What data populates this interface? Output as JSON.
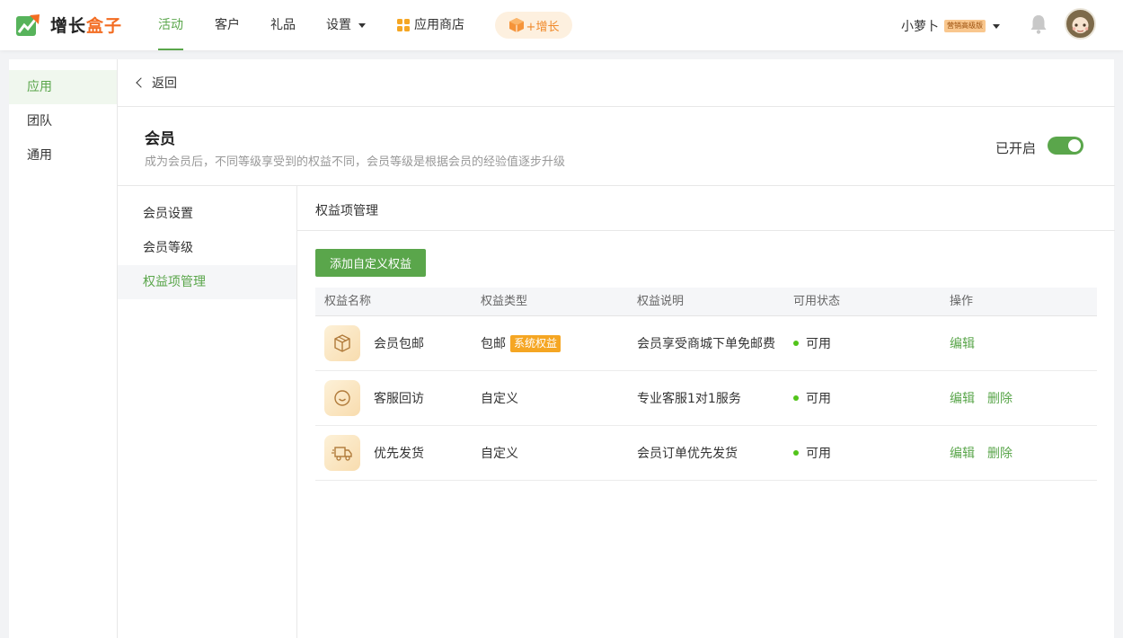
{
  "brand": {
    "name_part1": "增长",
    "name_part2": "盒子"
  },
  "nav": {
    "items": [
      "活动",
      "客户",
      "礼品",
      "设置",
      "应用商店"
    ],
    "grow_label": "+增长"
  },
  "user": {
    "name": "小萝卜",
    "badge": "营销高级版"
  },
  "sidebar": {
    "items": [
      "应用",
      "团队",
      "通用"
    ]
  },
  "page": {
    "back_label": "返回",
    "title": "会员",
    "description": "成为会员后，不同等级享受到的权益不同，会员等级是根据会员的经验值逐步升级",
    "toggle_label": "已开启",
    "toggle_on": true
  },
  "subnav": {
    "items": [
      "会员设置",
      "会员等级",
      "权益项管理"
    ]
  },
  "content": {
    "title": "权益项管理",
    "add_button": "添加自定义权益",
    "columns": [
      "权益名称",
      "权益类型",
      "权益说明",
      "可用状态",
      "操作"
    ],
    "rows": [
      {
        "icon": "package-icon",
        "name": "会员包邮",
        "type": "包邮",
        "tag": "系统权益",
        "desc": "会员享受商城下单免邮费",
        "status": "可用",
        "ops": [
          "编辑"
        ]
      },
      {
        "icon": "smile-chat-icon",
        "name": "客服回访",
        "type": "自定义",
        "tag": "",
        "desc": "专业客服1对1服务",
        "status": "可用",
        "ops": [
          "编辑",
          "删除"
        ]
      },
      {
        "icon": "truck-icon",
        "name": "优先发货",
        "type": "自定义",
        "tag": "",
        "desc": "会员订单优先发货",
        "status": "可用",
        "ops": [
          "编辑",
          "删除"
        ]
      }
    ]
  },
  "colors": {
    "accent": "#5aa64b",
    "brand_orange": "#f36c21",
    "tag_orange": "#f5a623",
    "status_green": "#52c41a"
  }
}
